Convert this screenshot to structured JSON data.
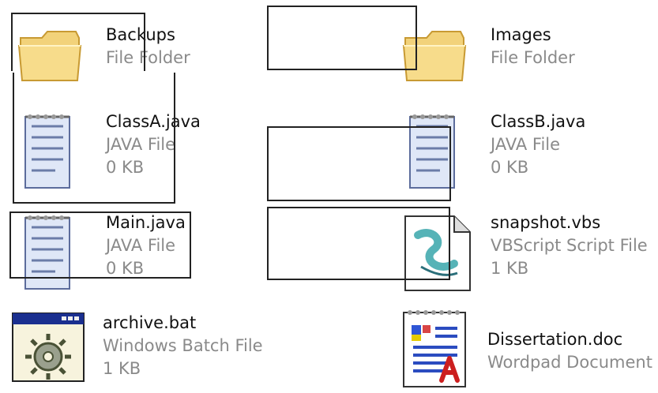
{
  "files": [
    {
      "name": "Backups",
      "type": "File Folder",
      "size": "",
      "icon": "folder-icon"
    },
    {
      "name": "Images",
      "type": "File Folder",
      "size": "",
      "icon": "folder-icon"
    },
    {
      "name": "ClassA.java",
      "type": "JAVA File",
      "size": "0 KB",
      "icon": "notepad-document-icon"
    },
    {
      "name": "ClassB.java",
      "type": "JAVA File",
      "size": "0 KB",
      "icon": "notepad-document-icon"
    },
    {
      "name": "Main.java",
      "type": "JAVA File",
      "size": "0 KB",
      "icon": "notepad-document-icon"
    },
    {
      "name": "snapshot.vbs",
      "type": "VBScript Script File",
      "size": "1 KB",
      "icon": "vbscript-icon"
    },
    {
      "name": "archive.bat",
      "type": "Windows Batch File",
      "size": "1 KB",
      "icon": "batch-gear-icon"
    },
    {
      "name": "Dissertation.doc",
      "type": "Wordpad Document",
      "size": "",
      "icon": "wordpad-document-icon"
    }
  ]
}
